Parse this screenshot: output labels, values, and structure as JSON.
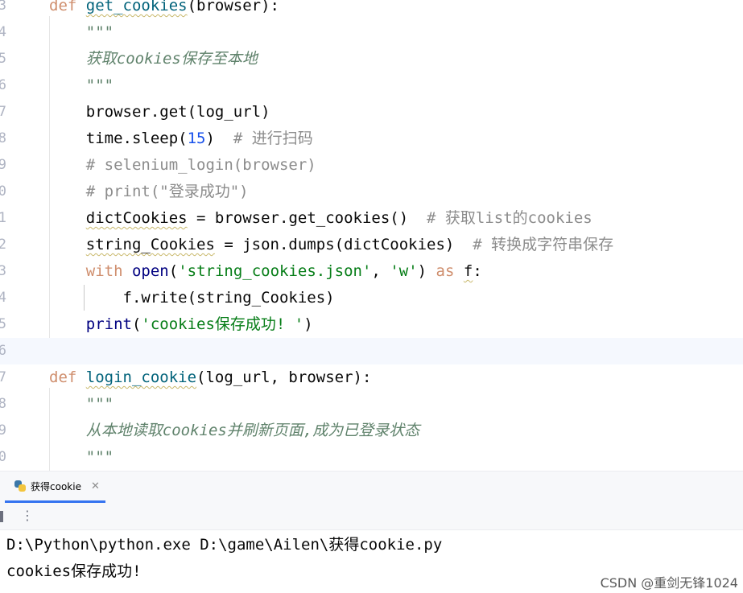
{
  "editor": {
    "line_numbers": [
      "3",
      "4",
      "5",
      "6",
      "7",
      "8",
      "9",
      "0",
      "1",
      "2",
      "3",
      "4",
      "5",
      "6",
      "7",
      "8",
      "9",
      "0"
    ],
    "lines": [
      {
        "tokens": [
          {
            "t": "def ",
            "c": "kw-def"
          },
          {
            "t": "get_cookies",
            "c": "fn-def underline-wave"
          },
          {
            "t": "(browser):",
            "c": ""
          }
        ]
      },
      {
        "tokens": [
          {
            "t": "    \"\"\"",
            "c": "doc-green"
          }
        ]
      },
      {
        "tokens": [
          {
            "t": "    获取cookies保存至本地",
            "c": "doc-green"
          }
        ]
      },
      {
        "tokens": [
          {
            "t": "    \"\"\"",
            "c": "doc-green"
          }
        ]
      },
      {
        "tokens": [
          {
            "t": "    browser.get(log_url)",
            "c": ""
          }
        ]
      },
      {
        "tokens": [
          {
            "t": "    time.sleep(",
            "c": ""
          },
          {
            "t": "15",
            "c": "num"
          },
          {
            "t": ")  ",
            "c": ""
          },
          {
            "t": "# 进行扫码",
            "c": "comment"
          }
        ]
      },
      {
        "tokens": [
          {
            "t": "    # selenium_login(browser)",
            "c": "comment"
          }
        ]
      },
      {
        "tokens": [
          {
            "t": "    # print(\"登录成功\")",
            "c": "comment"
          }
        ]
      },
      {
        "tokens": [
          {
            "t": "    ",
            "c": ""
          },
          {
            "t": "dictCookies",
            "c": "underline-wave"
          },
          {
            "t": " = browser.get_cookies()  ",
            "c": ""
          },
          {
            "t": "# 获取list的cookies",
            "c": "comment"
          }
        ]
      },
      {
        "tokens": [
          {
            "t": "    ",
            "c": ""
          },
          {
            "t": "string_Cookies",
            "c": "underline-wave"
          },
          {
            "t": " = json.dumps(dictCookies)  ",
            "c": ""
          },
          {
            "t": "# 转换成字符串保存",
            "c": "comment"
          }
        ]
      },
      {
        "tokens": [
          {
            "t": "    ",
            "c": ""
          },
          {
            "t": "with",
            "c": "kw-orange"
          },
          {
            "t": " ",
            "c": ""
          },
          {
            "t": "open",
            "c": "builtin"
          },
          {
            "t": "(",
            "c": ""
          },
          {
            "t": "'string_cookies.json'",
            "c": "str"
          },
          {
            "t": ", ",
            "c": ""
          },
          {
            "t": "'w'",
            "c": "str"
          },
          {
            "t": ") ",
            "c": ""
          },
          {
            "t": "as",
            "c": "kw-orange"
          },
          {
            "t": " ",
            "c": ""
          },
          {
            "t": "f",
            "c": "underline-wave"
          },
          {
            "t": ":",
            "c": ""
          }
        ]
      },
      {
        "tokens": [
          {
            "t": "        f.write(string_Cookies)",
            "c": ""
          }
        ]
      },
      {
        "tokens": [
          {
            "t": "    ",
            "c": ""
          },
          {
            "t": "print",
            "c": "builtin"
          },
          {
            "t": "(",
            "c": ""
          },
          {
            "t": "'cookies保存成功! '",
            "c": "str"
          },
          {
            "t": ")",
            "c": ""
          }
        ]
      },
      {
        "tokens": [
          {
            "t": "",
            "c": ""
          }
        ]
      },
      {
        "tokens": [
          {
            "t": "def ",
            "c": "kw-def"
          },
          {
            "t": "login_cookie",
            "c": "fn-def underline-wave"
          },
          {
            "t": "(log_url, browser):",
            "c": ""
          }
        ]
      },
      {
        "tokens": [
          {
            "t": "    \"\"\"",
            "c": "doc-green"
          }
        ]
      },
      {
        "tokens": [
          {
            "t": "    从本地读取cookies并刷新页面,成为已登录状态",
            "c": "doc-green"
          }
        ]
      },
      {
        "tokens": [
          {
            "t": "    \"\"\"",
            "c": "doc-green"
          }
        ]
      }
    ],
    "current_line_index": 13
  },
  "run_panel": {
    "tab_label": "获得cookie",
    "tab_icon": "python-icon",
    "close_icon": "close-icon",
    "more_icon": "more-vertical-icon",
    "output": [
      "D:\\Python\\python.exe D:\\game\\Ailen\\获得cookie.py",
      "cookies保存成功!"
    ]
  },
  "watermark": "CSDN @重剑无锋1024",
  "colors": {
    "keyword": "#cf8e6d",
    "function": "#00627a",
    "string": "#067d17",
    "number": "#1750eb",
    "comment": "#8c8c8c",
    "docstring": "#5f826b",
    "tab_underline": "#3574f0"
  }
}
